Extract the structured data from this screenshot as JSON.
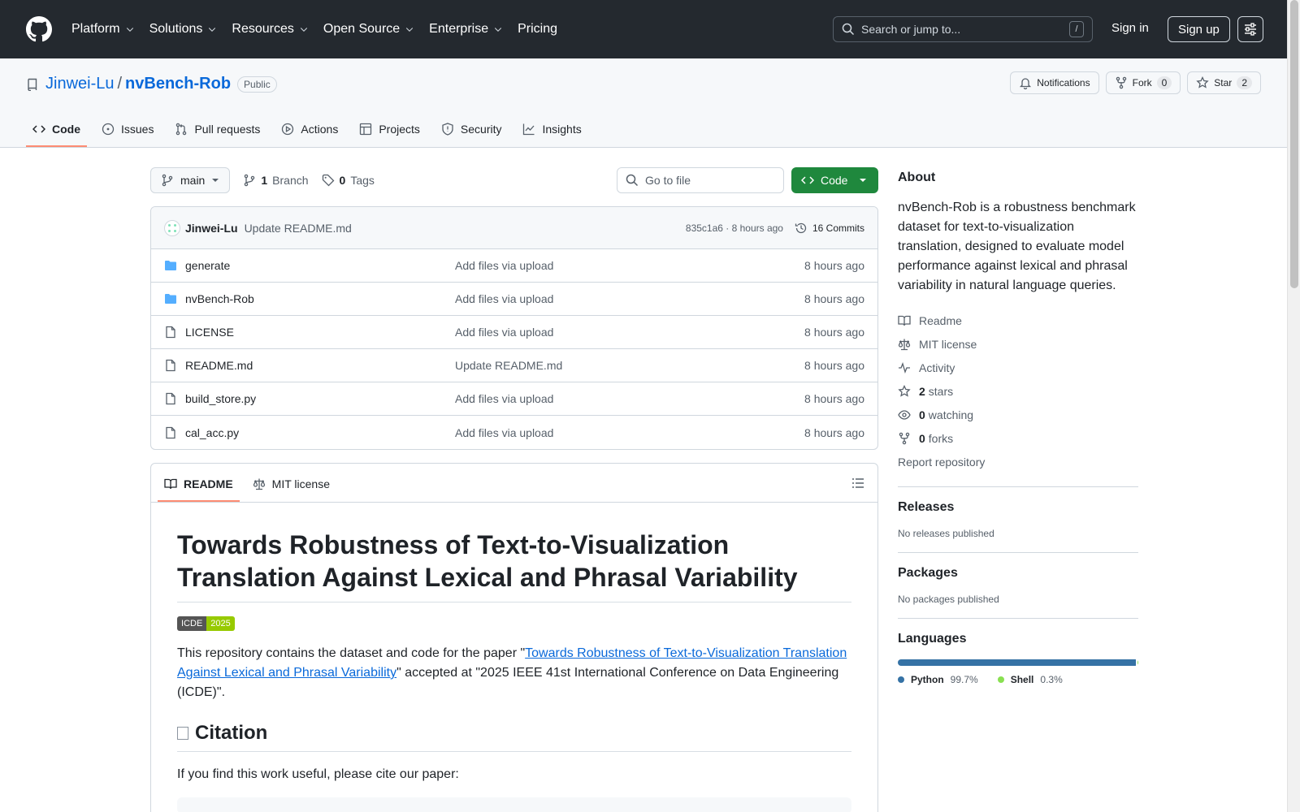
{
  "header": {
    "nav": [
      {
        "label": "Platform",
        "dropdown": true
      },
      {
        "label": "Solutions",
        "dropdown": true
      },
      {
        "label": "Resources",
        "dropdown": true
      },
      {
        "label": "Open Source",
        "dropdown": true
      },
      {
        "label": "Enterprise",
        "dropdown": true
      },
      {
        "label": "Pricing",
        "dropdown": false
      }
    ],
    "search_placeholder": "Search or jump to...",
    "search_shortcut": "/",
    "sign_in": "Sign in",
    "sign_up": "Sign up"
  },
  "repo": {
    "owner": "Jinwei-Lu",
    "separator": "/",
    "name": "nvBench-Rob",
    "visibility": "Public",
    "notifications_label": "Notifications",
    "fork_label": "Fork",
    "fork_count": "0",
    "star_label": "Star",
    "star_count": "2",
    "tabs": [
      {
        "label": "Code",
        "icon": "code-icon",
        "active": true
      },
      {
        "label": "Issues",
        "icon": "issue-icon",
        "active": false
      },
      {
        "label": "Pull requests",
        "icon": "pull-request-icon",
        "active": false
      },
      {
        "label": "Actions",
        "icon": "play-icon",
        "active": false
      },
      {
        "label": "Projects",
        "icon": "table-icon",
        "active": false
      },
      {
        "label": "Security",
        "icon": "shield-icon",
        "active": false
      },
      {
        "label": "Insights",
        "icon": "graph-icon",
        "active": false
      }
    ]
  },
  "toolbar": {
    "branch": "main",
    "branch_count": "1",
    "branch_label": "Branch",
    "tag_count": "0",
    "tag_label": "Tags",
    "go_to_file": "Go to file",
    "code_label": "Code"
  },
  "latest_commit": {
    "author": "Jinwei-Lu",
    "message": "Update README.md",
    "hash_time": "835c1a6 · 8 hours ago",
    "commits": "16 Commits"
  },
  "files": [
    {
      "name": "generate",
      "type": "folder",
      "message": "Add files via upload",
      "time": "8 hours ago"
    },
    {
      "name": "nvBench-Rob",
      "type": "folder",
      "message": "Add files via upload",
      "time": "8 hours ago"
    },
    {
      "name": "LICENSE",
      "type": "file",
      "message": "Add files via upload",
      "time": "8 hours ago"
    },
    {
      "name": "README.md",
      "type": "file",
      "message": "Update README.md",
      "time": "8 hours ago"
    },
    {
      "name": "build_store.py",
      "type": "file",
      "message": "Add files via upload",
      "time": "8 hours ago"
    },
    {
      "name": "cal_acc.py",
      "type": "file",
      "message": "Add files via upload",
      "time": "8 hours ago"
    }
  ],
  "readme": {
    "tab_readme": "README",
    "tab_license": "MIT license",
    "title": "Towards Robustness of Text-to-Visualization Translation Against Lexical and Phrasal Variability",
    "badge_left": "ICDE",
    "badge_right": "2025",
    "intro_before": "This repository contains the dataset and code for the paper \"",
    "intro_link": "Towards Robustness of Text-to-Visualization Translation Against Lexical and Phrasal Variability",
    "intro_after": "\" accepted at \"2025 IEEE 41st International Conference on Data Engineering (ICDE)\".",
    "citation_heading": "Citation",
    "citation_text": "If you find this work useful, please cite our paper:"
  },
  "sidebar": {
    "about_heading": "About",
    "description": "nvBench-Rob is a robustness benchmark dataset for text-to-visualization translation, designed to evaluate model performance against lexical and phrasal variability in natural language queries.",
    "links": [
      {
        "icon": "book-icon",
        "count": "",
        "label": "Readme"
      },
      {
        "icon": "law-icon",
        "count": "",
        "label": "MIT license"
      },
      {
        "icon": "pulse-icon",
        "count": "",
        "label": "Activity"
      },
      {
        "icon": "star-icon",
        "count": "2",
        "label": "stars"
      },
      {
        "icon": "eye-icon",
        "count": "0",
        "label": "watching"
      },
      {
        "icon": "fork-icon",
        "count": "0",
        "label": "forks"
      }
    ],
    "report": "Report repository",
    "releases_heading": "Releases",
    "releases_text": "No releases published",
    "packages_heading": "Packages",
    "packages_text": "No packages published",
    "languages_heading": "Languages",
    "languages": [
      {
        "name": "Python",
        "percent": "99.7%",
        "share": 99.7,
        "color": "#3572A5"
      },
      {
        "name": "Shell",
        "percent": "0.3%",
        "share": 0.3,
        "color": "#89e051"
      }
    ]
  },
  "colors": {
    "header_bg": "#24292f",
    "link": "#0969da",
    "primary_button": "#1f883d",
    "active_tab_underline": "#fd8c73"
  }
}
